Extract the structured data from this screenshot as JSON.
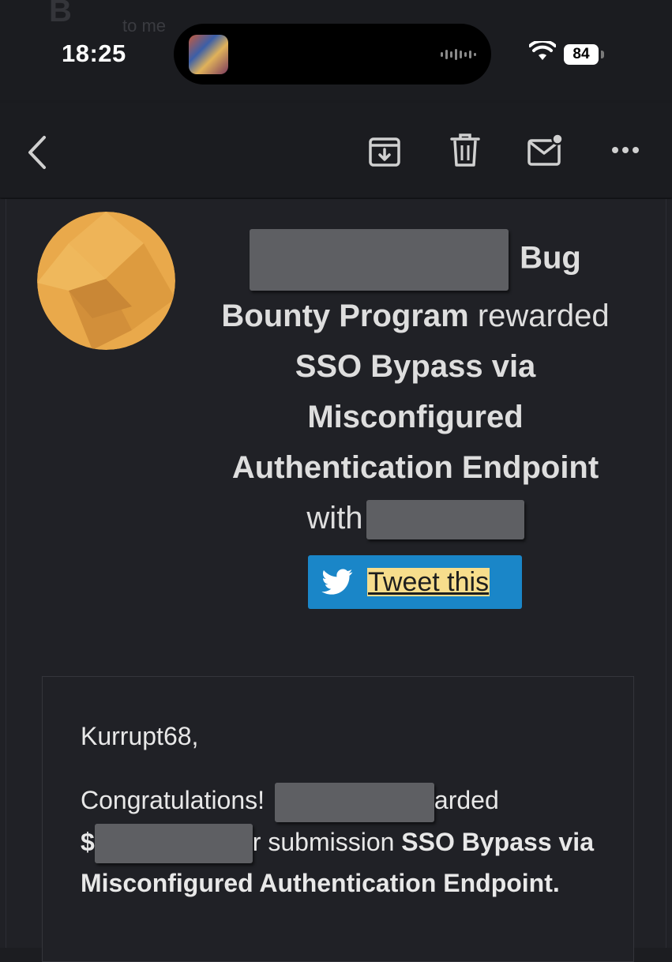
{
  "status_bar": {
    "time": "18:25",
    "battery": "84",
    "ghost_sender_initial": "B",
    "ghost_recipient": "to me"
  },
  "toolbar": {
    "back_icon": "chevron-left-icon",
    "archive_icon": "archive-icon",
    "delete_icon": "trash-icon",
    "mark_unread_icon": "mail-unread-icon",
    "more_icon": "more-horizontal-icon"
  },
  "email": {
    "heading": {
      "program_suffix": "Bug",
      "program_line2": "Bounty Program",
      "rewarded": " rewarded",
      "report_title": "SSO Bypass via Misconfigured Authentication Endpoint",
      "with": "with"
    },
    "tweet_button": {
      "label": "Tweet this",
      "icon": "twitter-bird-icon"
    },
    "body": {
      "greeting": "Kurrupt68,",
      "congrats": "Congratulations! ",
      "awarded_fragment": "arded",
      "currency": "$",
      "submission_fragment": "r submission ",
      "report_title": "SSO Bypass via Misconfigured Authentication Endpoint."
    }
  },
  "colors": {
    "background": "#1c1d21",
    "logo": "#e9a94b",
    "tweet_button": "#1a86c8",
    "highlight": "#f7dd8c",
    "redaction": "#5e5f63"
  }
}
